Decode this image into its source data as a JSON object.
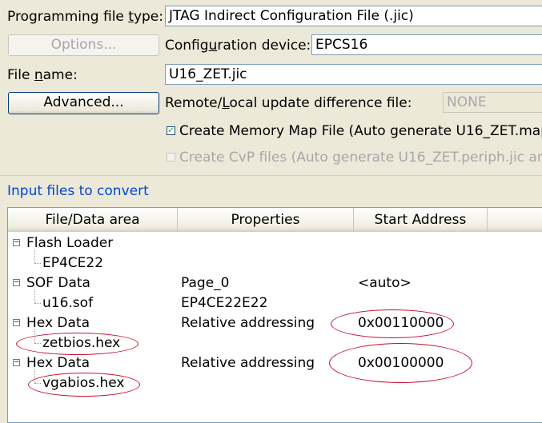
{
  "form": {
    "programming_file_type_label": "Programming file type:",
    "programming_file_type_value": "JTAG Indirect Configuration File (.jic)",
    "options_button": "Options...",
    "configuration_device_label": "Configuration device:",
    "configuration_device_value": "EPCS16",
    "file_name_label": "File name:",
    "file_name_value": "U16_ZET.jic",
    "advanced_button": "Advanced...",
    "remote_local_label": "Remote/Local update difference file:",
    "remote_local_value": "NONE",
    "create_memory_map_label": "Create Memory Map File (Auto generate U16_ZET.map",
    "create_memory_map_checked": true,
    "create_cvp_label": "Create CvP files (Auto generate U16_ZET.periph.jic an",
    "create_cvp_checked": false
  },
  "input_files": {
    "title": "Input files to convert",
    "columns": [
      "File/Data area",
      "Properties",
      "Start Address"
    ],
    "rows": [
      {
        "level": 0,
        "name": "Flash Loader",
        "properties": "",
        "start": ""
      },
      {
        "level": 1,
        "name": "EP4CE22",
        "properties": "",
        "start": ""
      },
      {
        "level": 0,
        "name": "SOF Data",
        "properties": "Page_0",
        "start": "<auto>"
      },
      {
        "level": 1,
        "name": "u16.sof",
        "properties": "EP4CE22E22",
        "start": ""
      },
      {
        "level": 0,
        "name": "Hex Data",
        "properties": "Relative addressing",
        "start": "0x00110000"
      },
      {
        "level": 1,
        "name": "zetbios.hex",
        "properties": "",
        "start": ""
      },
      {
        "level": 0,
        "name": "Hex Data",
        "properties": "Relative addressing",
        "start": "0x00100000"
      },
      {
        "level": 1,
        "name": "vgabios.hex",
        "properties": "",
        "start": ""
      }
    ]
  },
  "colors": {
    "annotation_ellipse": "#c8102e",
    "group_title": "#0046d5",
    "window_bg": "#ece9d8"
  },
  "icons": {
    "check": "check-icon",
    "tree_collapse": "minus-box-icon"
  }
}
